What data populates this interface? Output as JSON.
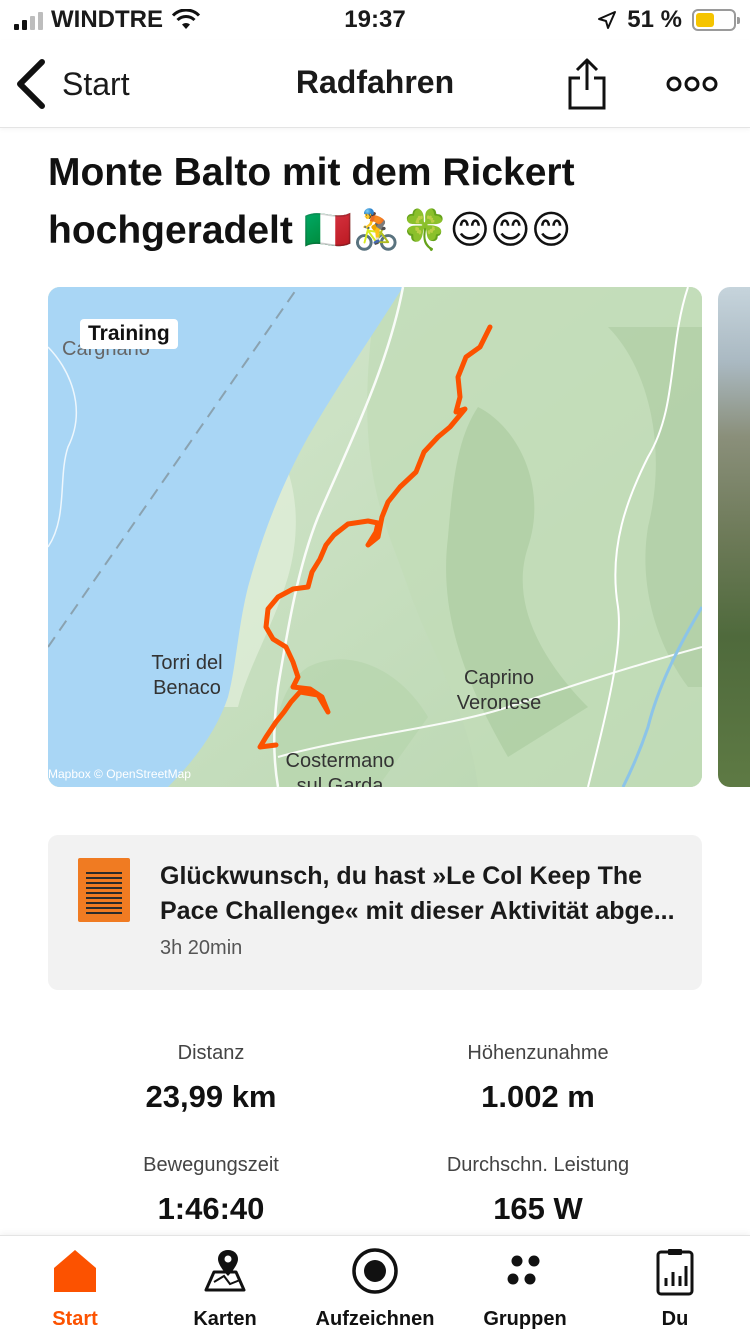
{
  "status_bar": {
    "carrier": "WINDTRE",
    "time": "19:37",
    "battery": "51 %",
    "battery_level": 0.51
  },
  "nav": {
    "back_label": "Start",
    "title": "Radfahren",
    "share_icon": "share-icon",
    "more_icon": "more-icon"
  },
  "activity": {
    "title": "Monte Balto mit dem Rickert hochgeradelt 🇮🇹🚴🍀😊😊😊"
  },
  "map": {
    "badge": "Training",
    "places": {
      "carghano": "Carghano",
      "torri": "Torri del Benaco",
      "caprino": "Caprino Veronese",
      "costermano": "Costermano sul Garda"
    },
    "attribution": "Mapbox © OpenStreetMap",
    "route_color": "#fc5200",
    "lake_color": "#a9d6f5"
  },
  "achievement": {
    "line1": "Glückwunsch, du hast »Le Col Keep The",
    "line2": "Pace Challenge« mit dieser Aktivität abge...",
    "duration": "3h 20min",
    "badge_color": "#f07b22"
  },
  "stats": [
    {
      "label": "Distanz",
      "value": "23,99 km"
    },
    {
      "label": "Höhenzunahme",
      "value": "1.002 m"
    },
    {
      "label": "Bewegungszeit",
      "value": "1:46:40"
    },
    {
      "label": "Durchschn. Leistung",
      "value": "165 W"
    }
  ],
  "tabs": [
    {
      "label": "Start",
      "icon": "home-icon",
      "active": true
    },
    {
      "label": "Karten",
      "icon": "map-icon",
      "active": false
    },
    {
      "label": "Aufzeichnen",
      "icon": "record-icon",
      "active": false
    },
    {
      "label": "Gruppen",
      "icon": "groups-icon",
      "active": false
    },
    {
      "label": "Du",
      "icon": "profile-stats-icon",
      "active": false
    }
  ],
  "accent_color": "#fc5200"
}
